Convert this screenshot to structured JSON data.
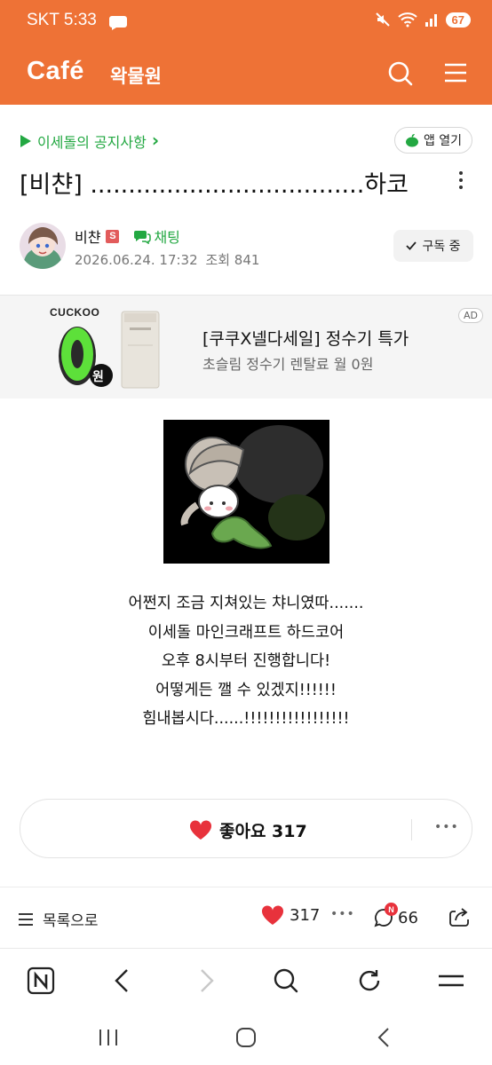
{
  "status_bar": {
    "carrier_time": "SKT 5:33",
    "battery": "67"
  },
  "header": {
    "brand": "Café",
    "cafe_name": "왁물원"
  },
  "notice": {
    "label": "이세돌의 공지사항",
    "arrow": "›",
    "open_app": "앱 열기"
  },
  "post": {
    "title": "[비챤] ....................................하코",
    "author": "비챤",
    "badge": "S",
    "chat": "채팅",
    "date": "2026.06.24. 17:32",
    "views": "조회 841",
    "subscribe": "구독 중",
    "lines": [
      "어쩐지 조금 지쳐있는 챠니였따.......",
      "이세돌 마인크래프트 하드코어",
      "오후 8시부터 진행합니다!",
      "어떻게든 깰 수 있겠지!!!!!!",
      "힘내봅시다......!!!!!!!!!!!!!!!!!"
    ],
    "like_label": "좋아요 317"
  },
  "ad": {
    "brand": "CUCKOO",
    "big_number": "0",
    "unit": "원",
    "headline": "[쿠쿠X넬다세일] 정수기 특가",
    "subline": "초슬림 정수기 렌탈료 월 0원",
    "tag": "AD"
  },
  "action_bar": {
    "list_label": "목록으로",
    "likes": "317",
    "comments": "66",
    "comment_badge": "N"
  },
  "icons": {
    "search": "search-icon",
    "menu": "hamburger-menu-icon",
    "kebab": "more-vertical-icon",
    "heart": "heart-icon",
    "comment": "comment-icon",
    "share": "share-icon",
    "naver": "naver-n-icon",
    "back": "back-icon",
    "forward": "forward-icon",
    "refresh": "refresh-icon",
    "browser_menu": "browser-menu-icon"
  },
  "colors": {
    "brand": "#ee7236",
    "green": "#23a842",
    "heart": "#e8323c"
  }
}
